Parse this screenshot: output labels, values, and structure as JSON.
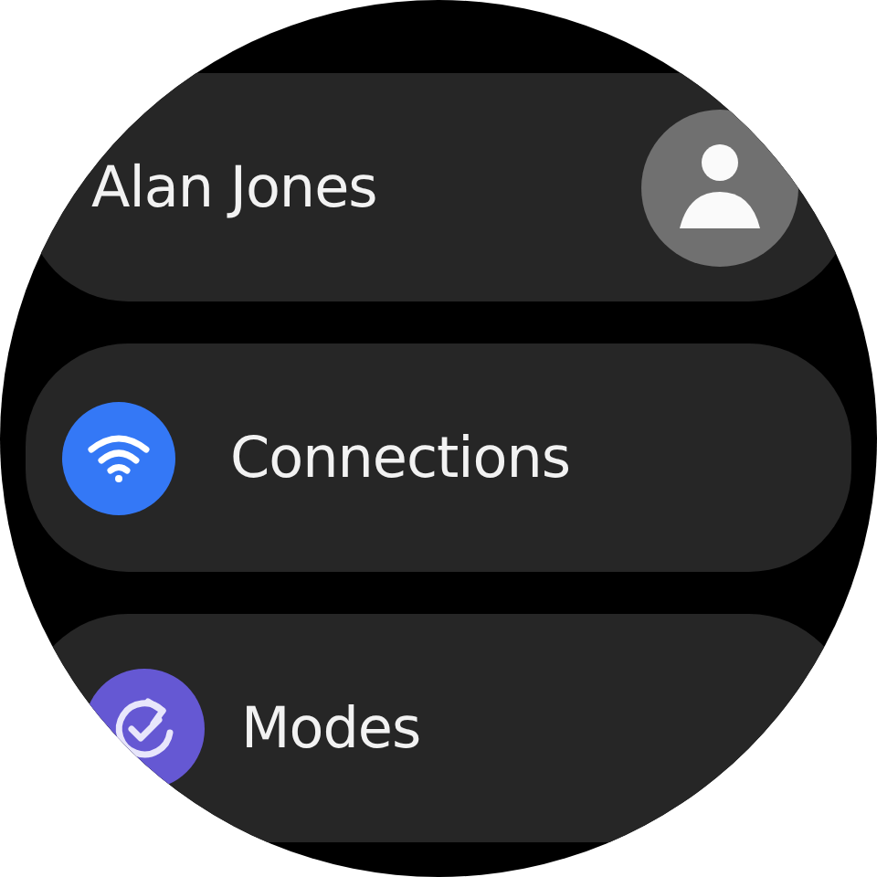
{
  "items": [
    {
      "kind": "profile",
      "label": "Alan Jones",
      "color": "#707070"
    },
    {
      "kind": "wifi",
      "label": "Connections",
      "color": "#3478f6"
    },
    {
      "kind": "modes",
      "label": "Modes",
      "color": "#6558d3"
    }
  ]
}
